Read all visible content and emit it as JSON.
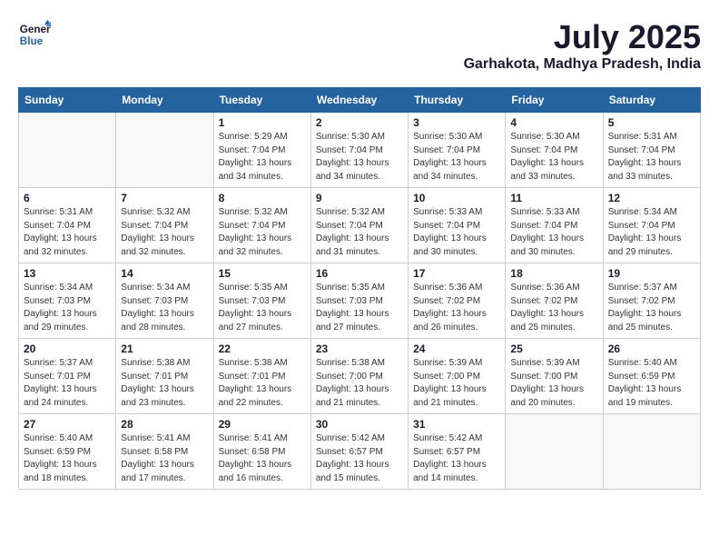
{
  "logo": {
    "line1": "General",
    "line2": "Blue"
  },
  "title": "July 2025",
  "subtitle": "Garhakota, Madhya Pradesh, India",
  "headers": [
    "Sunday",
    "Monday",
    "Tuesday",
    "Wednesday",
    "Thursday",
    "Friday",
    "Saturday"
  ],
  "weeks": [
    [
      {
        "day": "",
        "info": ""
      },
      {
        "day": "",
        "info": ""
      },
      {
        "day": "1",
        "info": "Sunrise: 5:29 AM\nSunset: 7:04 PM\nDaylight: 13 hours\nand 34 minutes."
      },
      {
        "day": "2",
        "info": "Sunrise: 5:30 AM\nSunset: 7:04 PM\nDaylight: 13 hours\nand 34 minutes."
      },
      {
        "day": "3",
        "info": "Sunrise: 5:30 AM\nSunset: 7:04 PM\nDaylight: 13 hours\nand 34 minutes."
      },
      {
        "day": "4",
        "info": "Sunrise: 5:30 AM\nSunset: 7:04 PM\nDaylight: 13 hours\nand 33 minutes."
      },
      {
        "day": "5",
        "info": "Sunrise: 5:31 AM\nSunset: 7:04 PM\nDaylight: 13 hours\nand 33 minutes."
      }
    ],
    [
      {
        "day": "6",
        "info": "Sunrise: 5:31 AM\nSunset: 7:04 PM\nDaylight: 13 hours\nand 32 minutes."
      },
      {
        "day": "7",
        "info": "Sunrise: 5:32 AM\nSunset: 7:04 PM\nDaylight: 13 hours\nand 32 minutes."
      },
      {
        "day": "8",
        "info": "Sunrise: 5:32 AM\nSunset: 7:04 PM\nDaylight: 13 hours\nand 32 minutes."
      },
      {
        "day": "9",
        "info": "Sunrise: 5:32 AM\nSunset: 7:04 PM\nDaylight: 13 hours\nand 31 minutes."
      },
      {
        "day": "10",
        "info": "Sunrise: 5:33 AM\nSunset: 7:04 PM\nDaylight: 13 hours\nand 30 minutes."
      },
      {
        "day": "11",
        "info": "Sunrise: 5:33 AM\nSunset: 7:04 PM\nDaylight: 13 hours\nand 30 minutes."
      },
      {
        "day": "12",
        "info": "Sunrise: 5:34 AM\nSunset: 7:04 PM\nDaylight: 13 hours\nand 29 minutes."
      }
    ],
    [
      {
        "day": "13",
        "info": "Sunrise: 5:34 AM\nSunset: 7:03 PM\nDaylight: 13 hours\nand 29 minutes."
      },
      {
        "day": "14",
        "info": "Sunrise: 5:34 AM\nSunset: 7:03 PM\nDaylight: 13 hours\nand 28 minutes."
      },
      {
        "day": "15",
        "info": "Sunrise: 5:35 AM\nSunset: 7:03 PM\nDaylight: 13 hours\nand 27 minutes."
      },
      {
        "day": "16",
        "info": "Sunrise: 5:35 AM\nSunset: 7:03 PM\nDaylight: 13 hours\nand 27 minutes."
      },
      {
        "day": "17",
        "info": "Sunrise: 5:36 AM\nSunset: 7:02 PM\nDaylight: 13 hours\nand 26 minutes."
      },
      {
        "day": "18",
        "info": "Sunrise: 5:36 AM\nSunset: 7:02 PM\nDaylight: 13 hours\nand 25 minutes."
      },
      {
        "day": "19",
        "info": "Sunrise: 5:37 AM\nSunset: 7:02 PM\nDaylight: 13 hours\nand 25 minutes."
      }
    ],
    [
      {
        "day": "20",
        "info": "Sunrise: 5:37 AM\nSunset: 7:01 PM\nDaylight: 13 hours\nand 24 minutes."
      },
      {
        "day": "21",
        "info": "Sunrise: 5:38 AM\nSunset: 7:01 PM\nDaylight: 13 hours\nand 23 minutes."
      },
      {
        "day": "22",
        "info": "Sunrise: 5:38 AM\nSunset: 7:01 PM\nDaylight: 13 hours\nand 22 minutes."
      },
      {
        "day": "23",
        "info": "Sunrise: 5:38 AM\nSunset: 7:00 PM\nDaylight: 13 hours\nand 21 minutes."
      },
      {
        "day": "24",
        "info": "Sunrise: 5:39 AM\nSunset: 7:00 PM\nDaylight: 13 hours\nand 21 minutes."
      },
      {
        "day": "25",
        "info": "Sunrise: 5:39 AM\nSunset: 7:00 PM\nDaylight: 13 hours\nand 20 minutes."
      },
      {
        "day": "26",
        "info": "Sunrise: 5:40 AM\nSunset: 6:59 PM\nDaylight: 13 hours\nand 19 minutes."
      }
    ],
    [
      {
        "day": "27",
        "info": "Sunrise: 5:40 AM\nSunset: 6:59 PM\nDaylight: 13 hours\nand 18 minutes."
      },
      {
        "day": "28",
        "info": "Sunrise: 5:41 AM\nSunset: 6:58 PM\nDaylight: 13 hours\nand 17 minutes."
      },
      {
        "day": "29",
        "info": "Sunrise: 5:41 AM\nSunset: 6:58 PM\nDaylight: 13 hours\nand 16 minutes."
      },
      {
        "day": "30",
        "info": "Sunrise: 5:42 AM\nSunset: 6:57 PM\nDaylight: 13 hours\nand 15 minutes."
      },
      {
        "day": "31",
        "info": "Sunrise: 5:42 AM\nSunset: 6:57 PM\nDaylight: 13 hours\nand 14 minutes."
      },
      {
        "day": "",
        "info": ""
      },
      {
        "day": "",
        "info": ""
      }
    ]
  ]
}
